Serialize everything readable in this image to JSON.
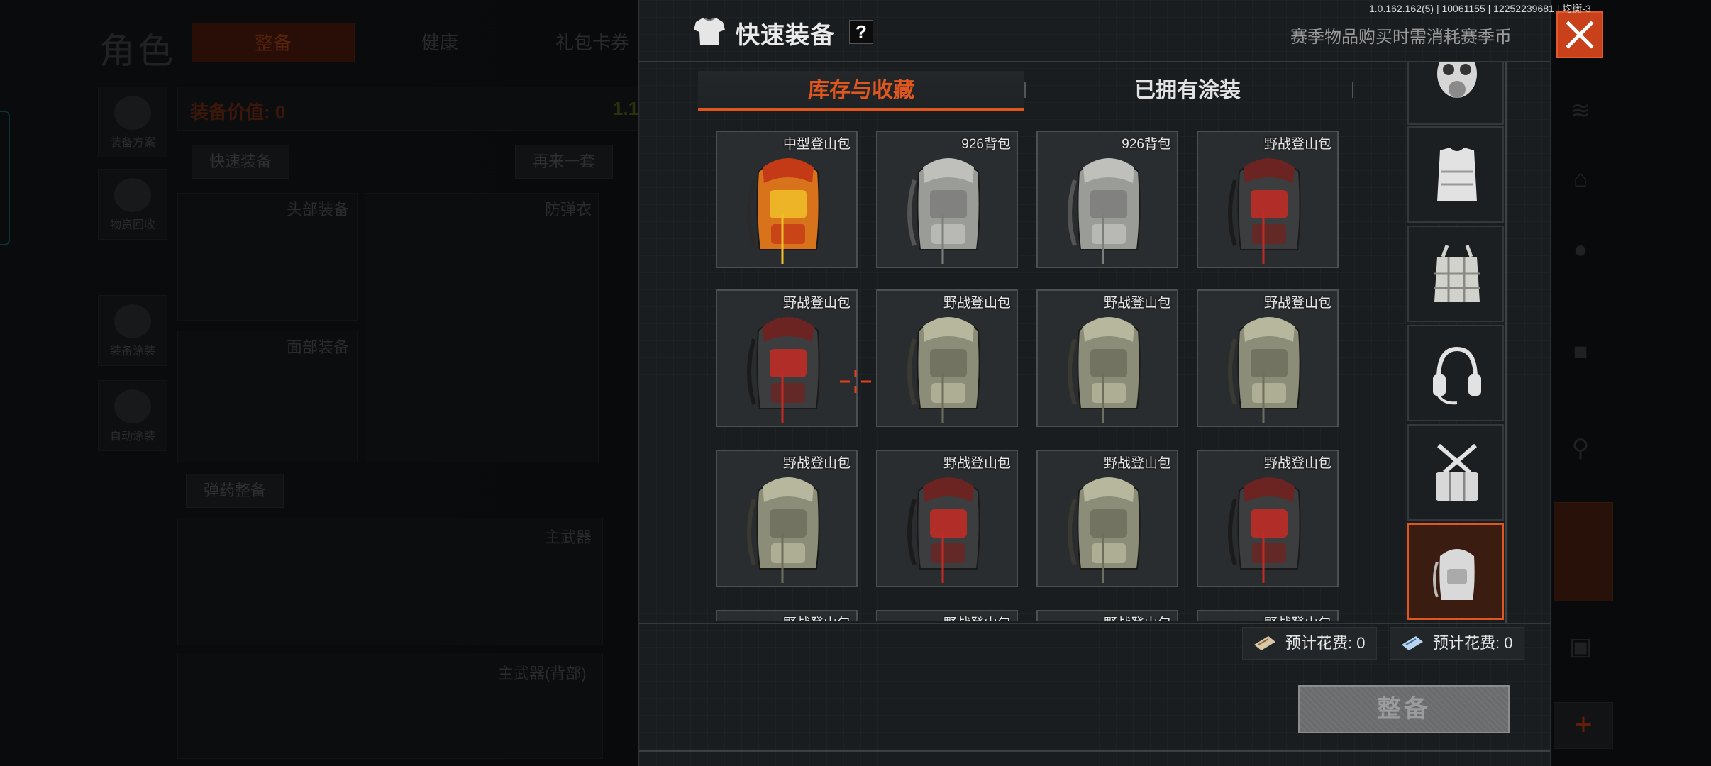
{
  "version_info": "1.0.162.162(5) | 10061155 | 12252239681 | 均衡-3",
  "background": {
    "title": "角色",
    "tabs": [
      "整备",
      "健康",
      "礼包卡券"
    ],
    "side_buttons": [
      "装备方案",
      "物资回收",
      "装备涂装",
      "自动涂装"
    ],
    "equip_value_label": "装备价值: 0",
    "value_right": "1.1",
    "quick_equip_label": "快速装备",
    "again_label": "再来一套",
    "slots": [
      "头部装备",
      "防弹衣",
      "面部装备"
    ],
    "ammo_label": "弹药整备",
    "main_weapon": "主武器",
    "main_weapon_back": "主武器(背部)"
  },
  "modal": {
    "title": "快速装备",
    "help": "?",
    "season_note": "赛季物品购买时需消耗赛季币",
    "tabs": [
      {
        "label": "库存与收藏",
        "active": true
      },
      {
        "label": "已拥有涂装",
        "active": false
      }
    ],
    "items": [
      {
        "name": "中型登山包",
        "style": "orange"
      },
      {
        "name": "926背包",
        "style": "gray"
      },
      {
        "name": "926背包",
        "style": "gray"
      },
      {
        "name": "野战登山包",
        "style": "red"
      },
      {
        "name": "野战登山包",
        "style": "red"
      },
      {
        "name": "野战登山包",
        "style": "olive"
      },
      {
        "name": "野战登山包",
        "style": "olive"
      },
      {
        "name": "野战登山包",
        "style": "olive"
      },
      {
        "name": "野战登山包",
        "style": "olive"
      },
      {
        "name": "野战登山包",
        "style": "red"
      },
      {
        "name": "野战登山包",
        "style": "olive"
      },
      {
        "name": "野战登山包",
        "style": "red"
      },
      {
        "name": "野战登山包",
        "style": "gray"
      },
      {
        "name": "野战登山包",
        "style": "gray"
      },
      {
        "name": "野战登山包",
        "style": "gray"
      },
      {
        "name": "野战登山包",
        "style": "gray"
      }
    ],
    "categories": [
      {
        "icon": "gas-mask-icon",
        "selected": false
      },
      {
        "icon": "body-armor-icon",
        "selected": false
      },
      {
        "icon": "chest-rig-icon",
        "selected": false
      },
      {
        "icon": "headset-icon",
        "selected": false
      },
      {
        "icon": "belt-pouch-icon",
        "selected": false
      },
      {
        "icon": "backpack-icon",
        "selected": true
      }
    ],
    "costs": [
      {
        "label": "预计花费: 0",
        "ticket": "season-ticket-icon"
      },
      {
        "label": "预计花费: 0",
        "ticket": "blue-ticket-icon"
      }
    ],
    "equip_button": "整备"
  },
  "colors": {
    "accent": "#e0561f",
    "close": "#c8411a",
    "panel": "#1a1d1f"
  }
}
